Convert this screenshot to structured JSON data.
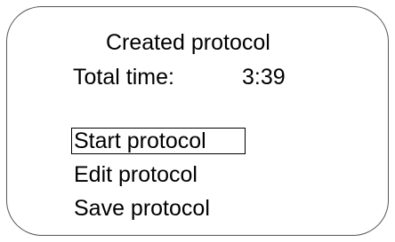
{
  "screen": {
    "title": "Created protocol",
    "total_time_label": "Total time:",
    "total_time_value": "3:39"
  },
  "menu": {
    "selected_index": 0,
    "items": [
      {
        "label": "Start protocol"
      },
      {
        "label": "Edit protocol"
      },
      {
        "label": "Save protocol"
      }
    ]
  },
  "colors": {
    "background": "#ffffff",
    "frame_border": "#555555",
    "text": "#000000",
    "selection_border": "#000000"
  }
}
